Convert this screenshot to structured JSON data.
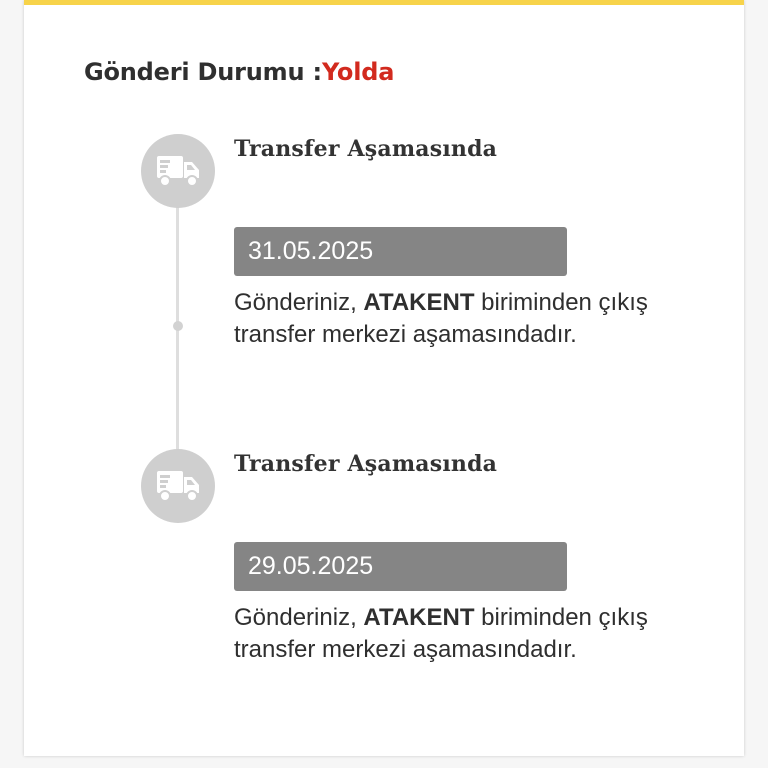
{
  "colors": {
    "accent": "#f7d34a",
    "status_value": "#d22a1e",
    "date_bg": "#858585",
    "icon_bg": "#cfcfcf"
  },
  "status": {
    "label": "Gönderi Durumu :",
    "value": "Yolda"
  },
  "timeline": [
    {
      "icon": "delivery-truck-icon",
      "title": "Transfer Aşamasında",
      "date": "31.05.2025",
      "desc_prefix": "Gönderiniz, ",
      "desc_bold": "ATAKENT",
      "desc_suffix": " biriminden çıkış transfer merkezi aşamasındadır."
    },
    {
      "icon": "delivery-truck-icon",
      "title": "Transfer Aşamasında",
      "date": "29.05.2025",
      "desc_prefix": "Gönderiniz, ",
      "desc_bold": "ATAKENT",
      "desc_suffix": " biriminden çıkış transfer merkezi aşamasındadır."
    }
  ]
}
